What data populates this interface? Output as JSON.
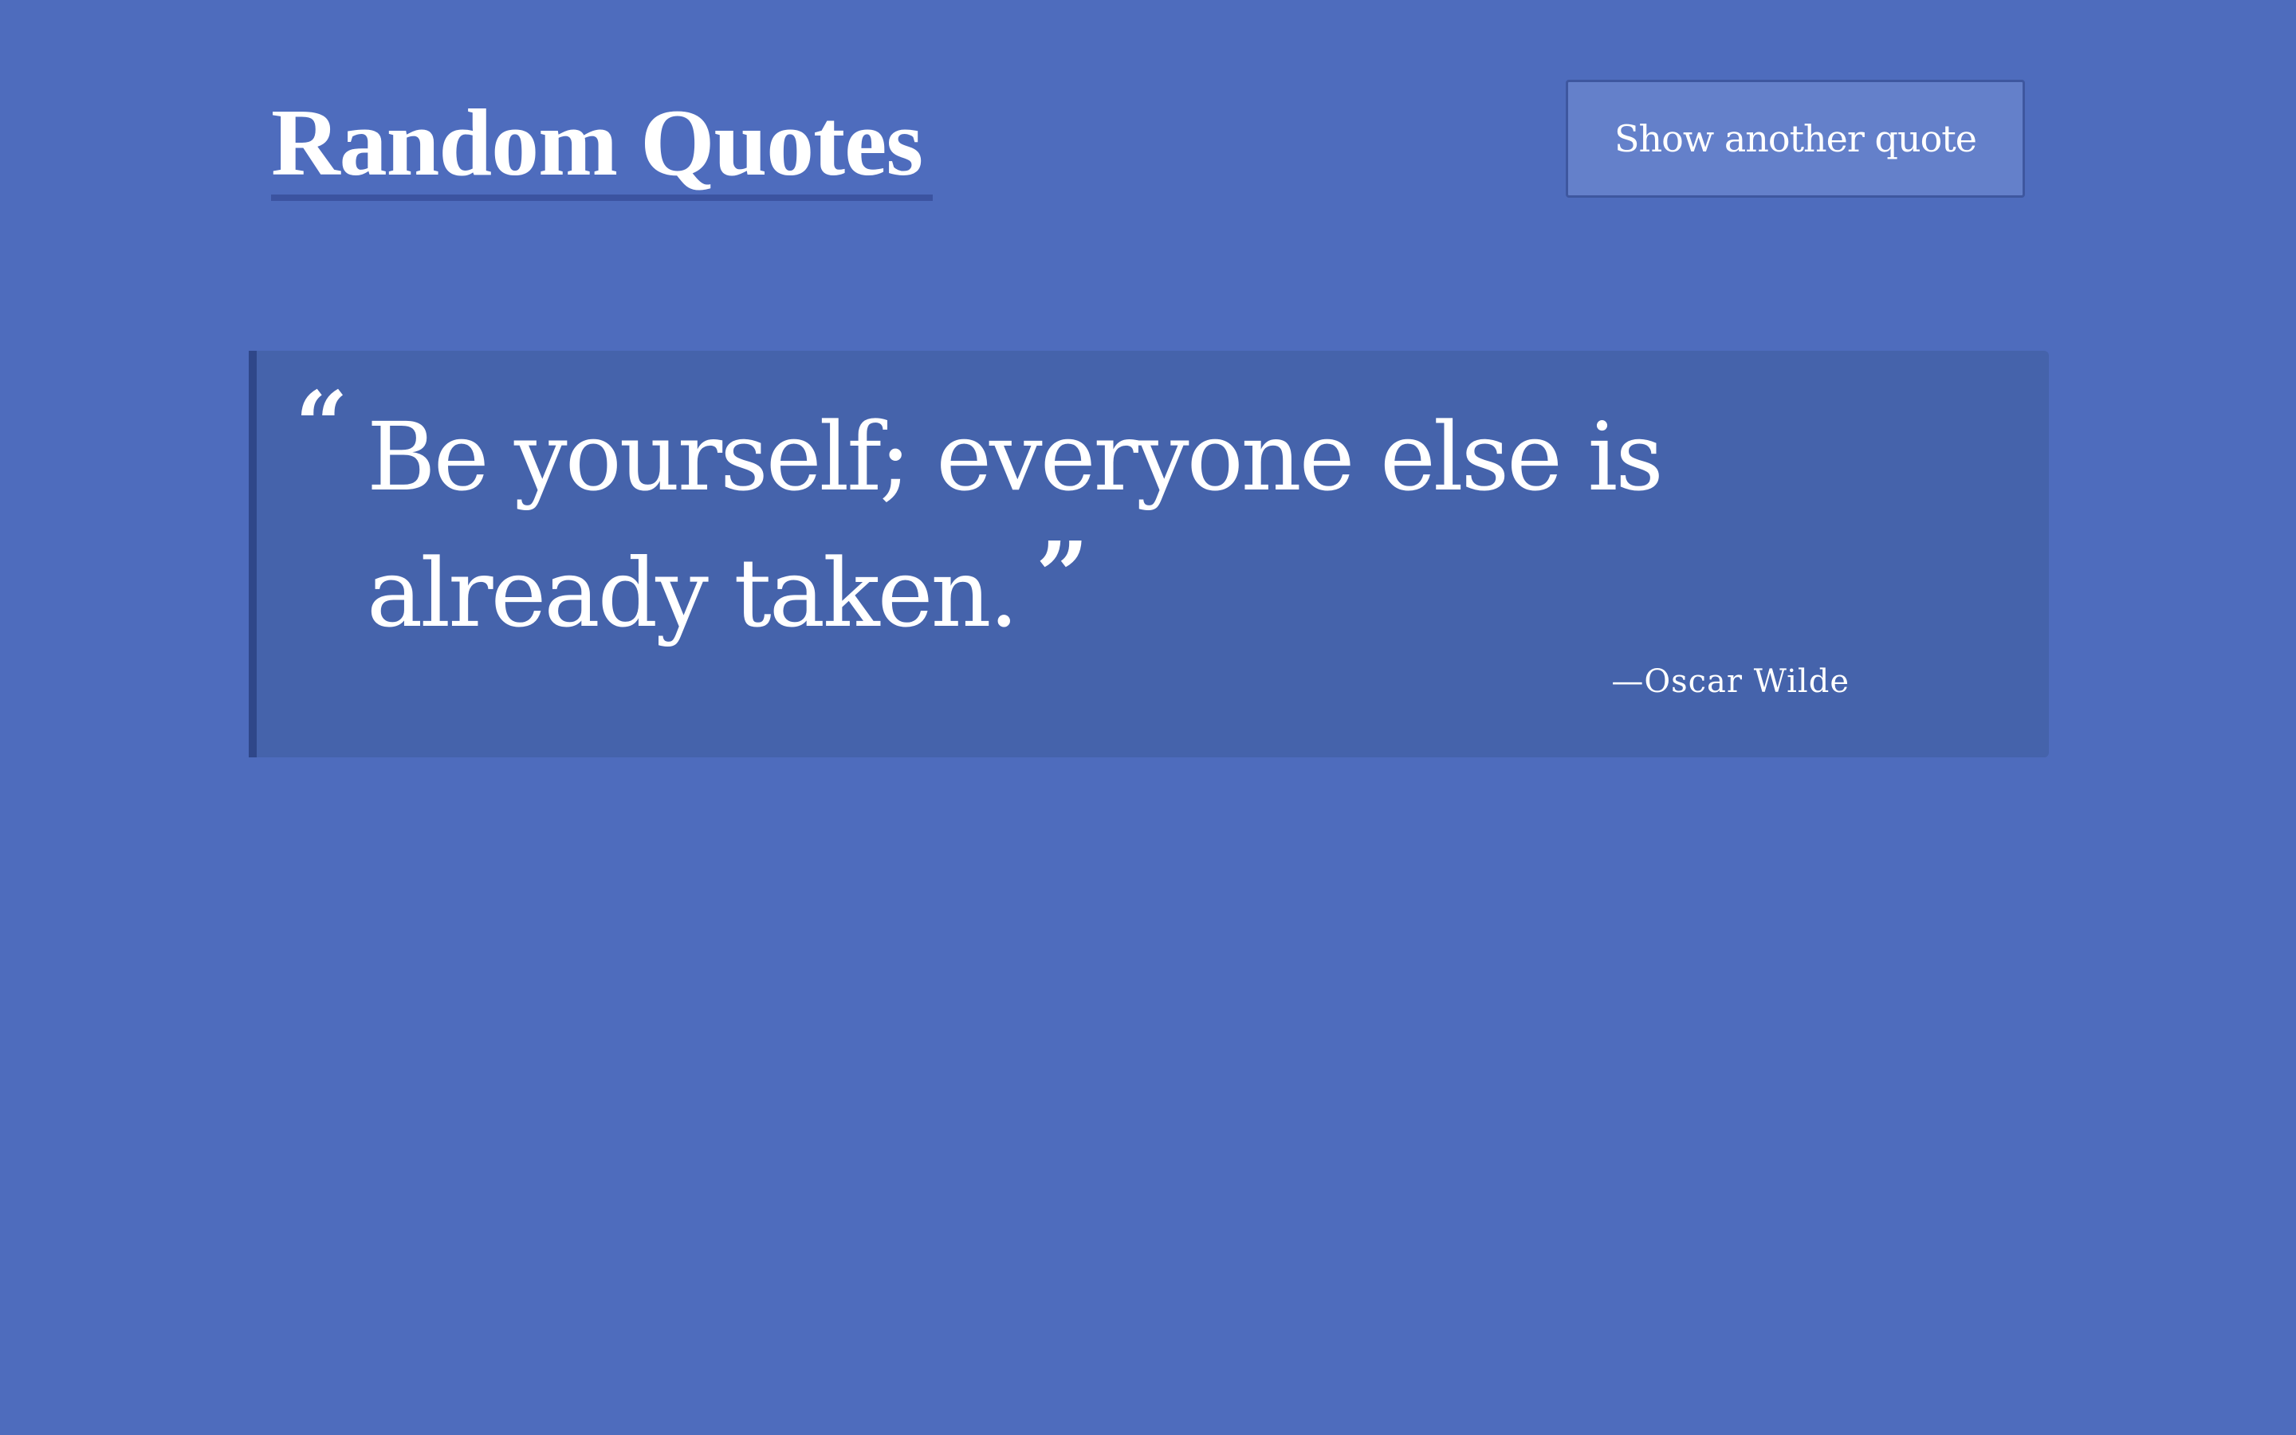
{
  "header": {
    "title": "Random Quotes",
    "button_label": "Show another quote"
  },
  "quote": {
    "open_mark": "“",
    "text": "Be yourself; everyone else is already taken.",
    "close_mark": "”",
    "author": "—Oscar Wilde"
  },
  "colors": {
    "background": "#4e6cbd",
    "card": "#4563ab",
    "card_border": "#2f4789",
    "button": "#6480ca",
    "button_border": "#3e579f",
    "title_underline": "#3b53a0",
    "text": "#ffffff"
  }
}
